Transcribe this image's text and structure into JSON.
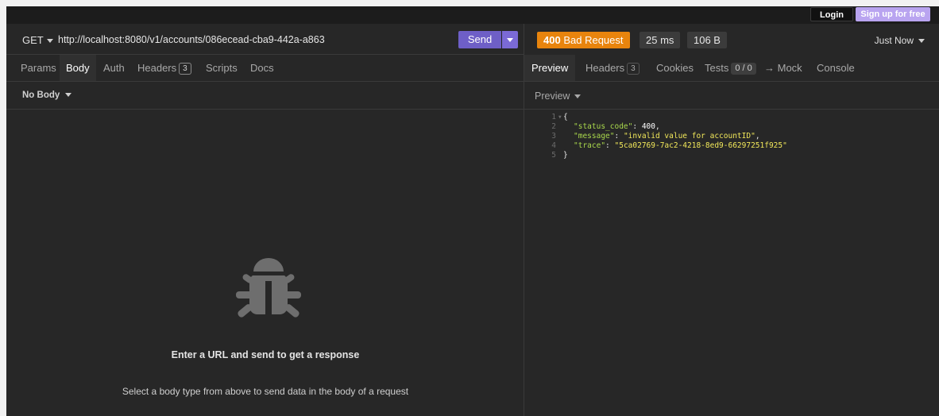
{
  "top": {
    "login": "Login",
    "signup": "Sign up for free"
  },
  "request": {
    "method": "GET",
    "url": "http://localhost:8080/v1/accounts/086ecead-cba9-442a-a863",
    "send": "Send",
    "tabs": [
      {
        "label": "Params"
      },
      {
        "label": "Body"
      },
      {
        "label": "Auth"
      },
      {
        "label": "Headers",
        "badge": "3"
      },
      {
        "label": "Scripts"
      },
      {
        "label": "Docs"
      }
    ],
    "body_type": "No Body",
    "empty_title": "Enter a URL and send to get a response",
    "empty_sub": "Select a body type from above to send data in the body of a request"
  },
  "response": {
    "status_num": "400",
    "status_text": "Bad Request",
    "time": "25 ms",
    "size": "106 B",
    "when": "Just Now",
    "tabs": [
      {
        "label": "Preview"
      },
      {
        "label": "Headers",
        "badge": "3"
      },
      {
        "label": "Cookies"
      },
      {
        "label": "Tests",
        "badge": "0 / 0"
      },
      {
        "label": "→ Mock"
      },
      {
        "label": "Console"
      }
    ],
    "preview_mode": "Preview",
    "json_lines": [
      {
        "n": "1",
        "open": "{"
      },
      {
        "n": "2",
        "key": "\"status_code\"",
        "num": "400"
      },
      {
        "n": "3",
        "key": "\"message\"",
        "str": "\"invalid value for accountID\""
      },
      {
        "n": "4",
        "key": "\"trace\"",
        "str": "\"5ca02769-7ac2-4218-8ed9-66297251f925\""
      },
      {
        "n": "5",
        "close": "}"
      }
    ]
  },
  "colors": {
    "accent": "#6e5fc7",
    "status_error": "#e8840d",
    "json_key": "#aad94c",
    "json_string": "#f2e85a"
  }
}
